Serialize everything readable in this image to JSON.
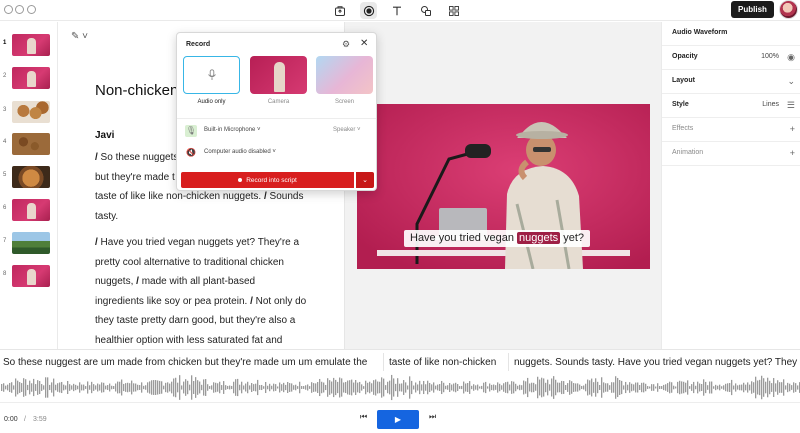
{
  "toolbar": {
    "tools": [
      "upload-icon",
      "record-icon",
      "text-icon",
      "shapes-icon",
      "grid-icon"
    ],
    "publish_label": "Publish"
  },
  "thumbnails": [
    {
      "num": "1",
      "kind": "pink"
    },
    {
      "num": "2",
      "kind": "pink"
    },
    {
      "num": "3",
      "kind": "nugget"
    },
    {
      "num": "4",
      "kind": "seeds"
    },
    {
      "num": "5",
      "kind": "bowl"
    },
    {
      "num": "6",
      "kind": "pink"
    },
    {
      "num": "7",
      "kind": "landscape"
    },
    {
      "num": "8",
      "kind": "pink"
    }
  ],
  "script": {
    "title": "Non-chicken",
    "speaker": "Javi",
    "para1": [
      {
        "t": "/",
        "b": true
      },
      {
        "t": " So these nuggets",
        "b": false
      },
      {
        "t": "\nbut they're made t",
        "b": false
      },
      {
        "t": "\ntaste of like like non-chicken nuggets. ",
        "b": false
      },
      {
        "t": "/",
        "b": true
      },
      {
        "t": " Sounds\ntasty.",
        "b": false
      }
    ],
    "para2": [
      {
        "t": "/",
        "b": true
      },
      {
        "t": " Have you tried vegan nuggets yet? They're a\npretty cool alternative to traditional chicken\nnuggets, ",
        "b": false
      },
      {
        "t": "/",
        "b": true
      },
      {
        "t": " made with all plant-based\ningredients like soy or pea protein. ",
        "b": false
      },
      {
        "t": "/",
        "b": true
      },
      {
        "t": " Not only do\nthey taste pretty darn good, but they're also a\nhealthier option with less saturated fat and",
        "b": false
      }
    ]
  },
  "record_popup": {
    "title": "Record",
    "modes": [
      "Audio only",
      "Camera",
      "Screen"
    ],
    "mic_label": "Built-in Microphone",
    "speaker_label": "Speaker",
    "computer_audio_label": "Computer audio disabled",
    "record_button": "Record into script"
  },
  "canvas": {
    "caption_before": "Have you tried vegan ",
    "caption_highlight": "nuggets",
    "caption_after": " yet?"
  },
  "inspector": {
    "header": "Audio Waveform",
    "opacity_label": "Opacity",
    "opacity_value": "100%",
    "layout_label": "Layout",
    "style_label": "Style",
    "style_value": "Lines",
    "effects_label": "Effects",
    "animation_label": "Animation"
  },
  "transcript": {
    "segments": [
      "So these nuggest are um made from chicken but they're made um um emulate the",
      "taste of like non-chicken",
      "nuggets. Sounds tasty. Have you tried vegan nuggets yet? They"
    ]
  },
  "transport": {
    "current_time": "0:00",
    "separator": "/",
    "duration": "3:59"
  },
  "colors": {
    "accent_blue": "#1565e0",
    "record_red": "#d81e1e",
    "video_bg": "#c8245d",
    "caption_highlight": "#9e1f45"
  }
}
